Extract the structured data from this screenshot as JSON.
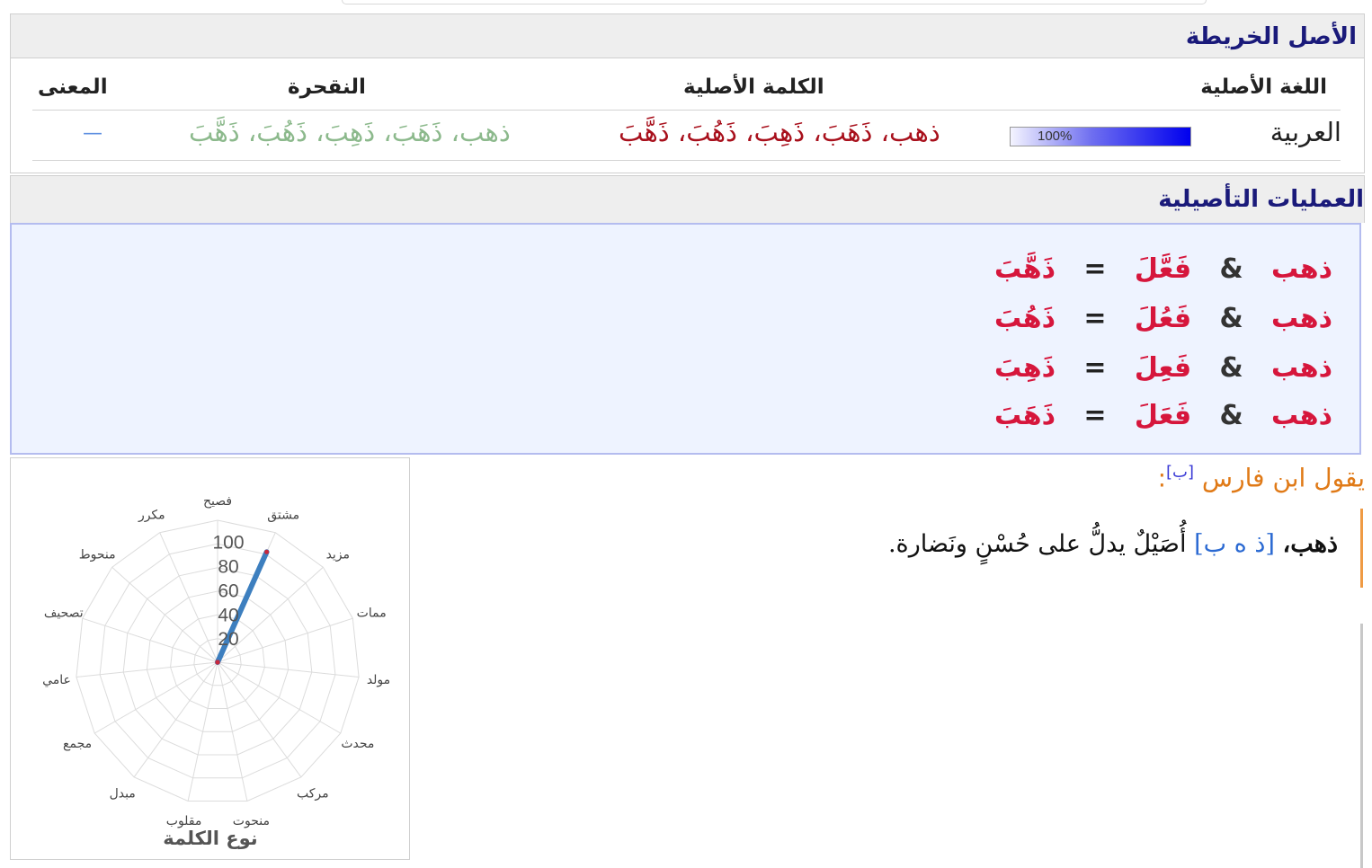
{
  "origin_section": {
    "title": "الأصل  الخريطة",
    "columns": {
      "language": "اللغة الأصلية",
      "word": "الكلمة الأصلية",
      "transliteration": "النقحرة",
      "meaning": "المعنى"
    },
    "row": {
      "language": "العربية",
      "progress": 100,
      "progress_label": "100%",
      "word": "ذهب، ذَهَبَ، ذَهِبَ، ذَهُبَ، ذَهَّبَ",
      "transliteration": "ذهب، ذَهَبَ، ذَهِبَ، ذَهُبَ، ذَهَّبَ",
      "meaning": "—"
    }
  },
  "ops_section": {
    "title": "العمليات التأصيلية",
    "ops": [
      {
        "root": "ذهب",
        "amp": "&",
        "pattern": "فَعَّلَ",
        "eq": "=",
        "result": "ذَهَّبَ"
      },
      {
        "root": "ذهب",
        "amp": "&",
        "pattern": "فَعُلَ",
        "eq": "=",
        "result": "ذَهُبَ"
      },
      {
        "root": "ذهب",
        "amp": "&",
        "pattern": "فَعِلَ",
        "eq": "=",
        "result": "ذَهِبَ"
      },
      {
        "root": "ذهب",
        "amp": "&",
        "pattern": "فَعَلَ",
        "eq": "=",
        "result": "ذَهَبَ"
      }
    ]
  },
  "quote": {
    "speaker": "يقول ابن فارس",
    "ref": "[ب]",
    "colon": ":",
    "headword": "ذهب،",
    "root_letters": "[ذ ه ب]",
    "definition": "أُصَيْلٌ يدلُّ على حُسْنٍ ونَضارة."
  },
  "chart_data": {
    "type": "radar",
    "title": "نوع الكلمة",
    "axes": [
      "فصيح",
      "مشتق",
      "مزيد",
      "ممات",
      "مولد",
      "محدث",
      "مركب",
      "منحوت",
      "مقلوب",
      "مبدل",
      "مجمع",
      "عامي",
      "تصحيف",
      "منحوط",
      "مكرر"
    ],
    "tick_labels": [
      "100",
      "80",
      "60",
      "40",
      "20"
    ],
    "rlim": [
      0,
      100
    ],
    "grid": true,
    "series": [
      {
        "values": [
          0,
          85,
          0,
          0,
          0,
          0,
          0,
          0,
          0,
          0,
          0,
          0,
          0,
          0,
          0
        ],
        "color": "#3d7fbf"
      }
    ]
  },
  "colors": {
    "header_text": "#1a1a7a",
    "word_red": "#a8101c",
    "translit_green": "#8cb98c",
    "op_red": "#d6163c",
    "quote_orange": "#e07a17",
    "progress_blue": "#0000ee"
  }
}
